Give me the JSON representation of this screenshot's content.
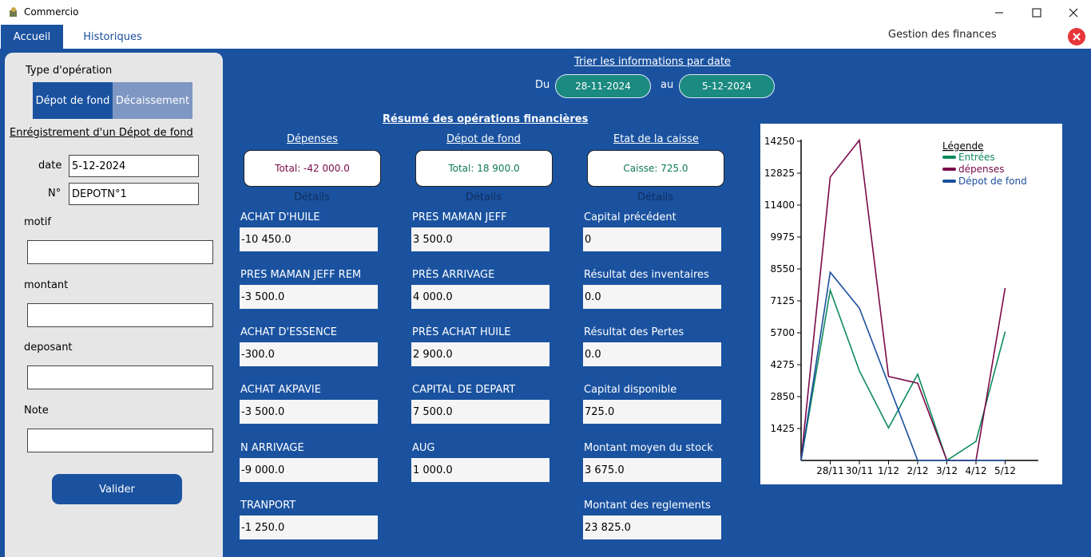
{
  "window": {
    "title": "Commercio",
    "icon": "app-icon"
  },
  "menu": {
    "tabs": [
      {
        "label": "Accueil",
        "active": true
      },
      {
        "label": "Historiques",
        "active": false
      }
    ],
    "section_title": "Gestion des finances"
  },
  "left": {
    "type_label": "Type d'opération",
    "toggle": [
      {
        "label": "Dépot de fond",
        "active": true
      },
      {
        "label": "Décaissement",
        "active": false
      }
    ],
    "form_title": "Enrégistrement d'un Dépot de fond",
    "date_label": "date",
    "date_value": "5-12-2024",
    "num_label": "N°",
    "num_value": "DEPOTN°1",
    "motif_label": "motif",
    "montant_label": "montant",
    "deposant_label": "deposant",
    "note_label": "Note",
    "submit_label": "Valider"
  },
  "filter": {
    "title": "Trier les informations par date",
    "from_label": "Du",
    "from_value": "28-11-2024",
    "to_label": "au",
    "to_value": "5-12-2024"
  },
  "summary": {
    "title": "Résumé des opérations financières",
    "columns": [
      {
        "header": "Dépenses",
        "total": "Total: -42 000.0",
        "color": "#7b0a46",
        "details": "Détails",
        "items": [
          {
            "label": "ACHAT D'HUILE",
            "value": "-10 450.0"
          },
          {
            "label": "PRES MAMAN JEFF REM",
            "value": "-3 500.0"
          },
          {
            "label": "ACHAT D'ESSENCE",
            "value": "-300.0"
          },
          {
            "label": "ACHAT AKPAVIE",
            "value": "-3 500.0"
          },
          {
            "label": "N ARRIVAGE",
            "value": "-9 000.0"
          },
          {
            "label": "TRANPORT",
            "value": "-1 250.0"
          }
        ]
      },
      {
        "header": "Dépot de fond",
        "total": "Total: 18 900.0",
        "color": "#0f7a52",
        "details": "Détails",
        "items": [
          {
            "label": "PRES MAMAN JEFF",
            "value": "3 500.0"
          },
          {
            "label": "PRÈS ARRIVAGE",
            "value": "4 000.0"
          },
          {
            "label": "PRÈS ACHAT HUILE",
            "value": "2 900.0"
          },
          {
            "label": "CAPITAL DE DEPART",
            "value": "7 500.0"
          },
          {
            "label": "AUG",
            "value": "1 000.0"
          }
        ]
      },
      {
        "header": "Etat de la caisse",
        "total": "Caisse: 725.0",
        "color": "#0f7a52",
        "details": "Détails",
        "items": [
          {
            "label": "Capital précédent",
            "value": "0"
          },
          {
            "label": "Résultat des inventaires",
            "value": "0.0"
          },
          {
            "label": "Résultat des Pertes",
            "value": "0.0"
          },
          {
            "label": "Capital disponible",
            "value": "725.0"
          },
          {
            "label": "Montant moyen du stock",
            "value": "3 675.0"
          },
          {
            "label": "Montant des reglements",
            "value": "23 825.0"
          }
        ]
      }
    ]
  },
  "chart_data": {
    "type": "line",
    "legend_title": "Légende",
    "legend_position": "top-right",
    "categories": [
      "28/11",
      "30/11",
      "1/12",
      "2/12",
      "3/12",
      "4/12",
      "5/12"
    ],
    "y_ticks": [
      1425,
      2850,
      4275,
      5700,
      7125,
      8550,
      9975,
      11400,
      12825,
      14250
    ],
    "ylim": [
      0,
      16000
    ],
    "series": [
      {
        "name": "Entrées",
        "color": "#0d8a5a",
        "x": [
          0,
          1,
          2,
          3,
          4,
          5,
          6,
          7
        ],
        "values": [
          0,
          7600,
          4000,
          1450,
          3850,
          0,
          850,
          5750
        ]
      },
      {
        "name": "dépenses",
        "color": "#7a0a4a",
        "x": [
          0,
          1,
          2,
          3,
          4,
          5,
          6,
          7
        ],
        "values": [
          0,
          12650,
          14300,
          3750,
          3450,
          0,
          0,
          7700
        ]
      },
      {
        "name": "Dépot de fond",
        "color": "#1a4f9c",
        "x": [
          0,
          1,
          2,
          3,
          4,
          5,
          6,
          7
        ],
        "values": [
          0,
          8400,
          6800,
          3400,
          0,
          0,
          0,
          0
        ]
      }
    ]
  }
}
